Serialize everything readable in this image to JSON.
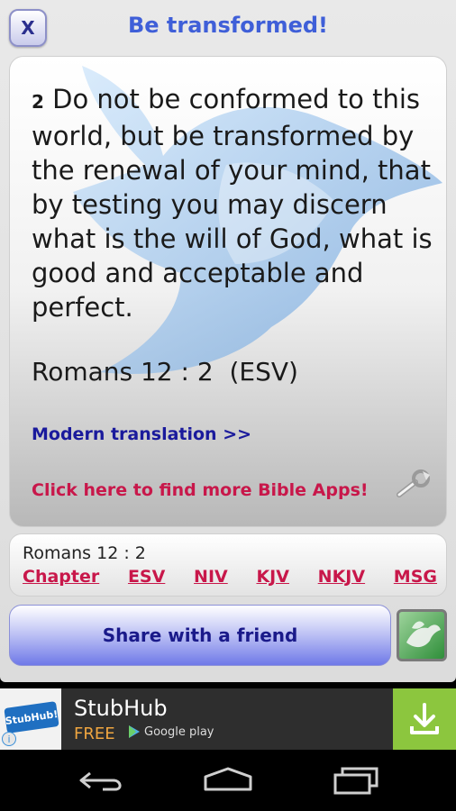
{
  "header": {
    "close_label": "X",
    "title": "Be transformed!"
  },
  "verse": {
    "number": "2",
    "text": "Do not be conformed to this world, but be transformed by the renewal of your mind, that by testing you may discern what is the will of God, what is good and acceptable and perfect.",
    "reference": "Romans 12 : 2  (ESV)",
    "modern_link": "Modern translation >>",
    "more_apps_link": "Click here to find more Bible Apps!"
  },
  "nav": {
    "reference": "Romans 12 : 2",
    "links": [
      "Chapter",
      "ESV",
      "NIV",
      "KJV",
      "NKJV",
      "MSG"
    ]
  },
  "share": {
    "label": "Share with a friend"
  },
  "ad": {
    "logo_text": "StubHub!",
    "info": "i",
    "title": "StubHub",
    "price": "FREE",
    "store": "Google play",
    "download_color": "#8cc63e"
  },
  "colors": {
    "title": "#3f5fd8",
    "link_blue": "#1a1a9c",
    "link_red": "#c8174a"
  }
}
